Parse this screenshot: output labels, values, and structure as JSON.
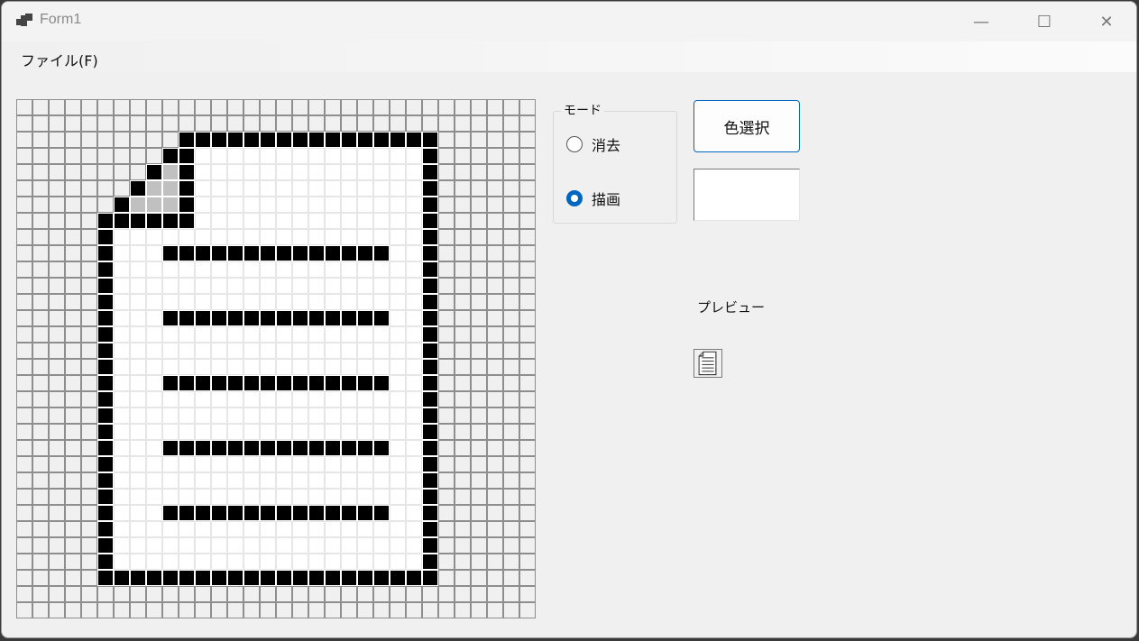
{
  "window": {
    "title": "Form1",
    "minimize_glyph": "—",
    "maximize_glyph": "☐",
    "close_glyph": "✕"
  },
  "menu": {
    "items": [
      {
        "label": "ファイル(F)"
      }
    ]
  },
  "mode_group": {
    "label": "モード",
    "options": [
      {
        "label": "消去",
        "checked": false
      },
      {
        "label": "描画",
        "checked": true
      }
    ]
  },
  "color_button": {
    "label": "色選択"
  },
  "selected_color": "#ffffff",
  "preview": {
    "label": "プレビュー"
  },
  "canvas": {
    "columns": 32,
    "rows": 32,
    "legend": {
      "T": "transparent",
      "W": "white",
      "B": "black",
      "G": "gray"
    },
    "pixels": [
      "TTTTTTTTTTTTTTTTTTTTTTTTTTTTTTTT",
      "TTTTTTTTTTTTTTTTTTTTTTTTTTTTTTTT",
      "TTTTTTTTTTBBBBBBBBBBBBBBBBTTTTTT",
      "TTTTTTTTTBBWWWWWWWWWWWWWWBTTTTTT",
      "TTTTTTTTBGBWWWWWWWWWWWWWWBTTTTTT",
      "TTTTTTTBGGBWWWWWWWWWWWWWWBTTTTTT",
      "TTTTTTBGGGBWWWWWWWWWWWWWWBTTTTTT",
      "TTTTTBBBBBBWWWWWWWWWWWWWWBTTTTTT",
      "TTTTTBWWWWWWWWWWWWWWWWWWWBTTTTTT",
      "TTTTTBWWWBBBBBBBBBBBBBBWWBTTTTTT",
      "TTTTTBWWWWWWWWWWWWWWWWWWWBTTTTTT",
      "TTTTTBWWWWWWWWWWWWWWWWWWWBTTTTTT",
      "TTTTTBWWWWWWWWWWWWWWWWWWWBTTTTTT",
      "TTTTTBWWWBBBBBBBBBBBBBBWWBTTTTTT",
      "TTTTTBWWWWWWWWWWWWWWWWWWWBTTTTTT",
      "TTTTTBWWWWWWWWWWWWWWWWWWWBTTTTTT",
      "TTTTTBWWWWWWWWWWWWWWWWWWWBTTTTTT",
      "TTTTTBWWWBBBBBBBBBBBBBBWWBTTTTTT",
      "TTTTTBWWWWWWWWWWWWWWWWWWWBTTTTTT",
      "TTTTTBWWWWWWWWWWWWWWWWWWWBTTTTTT",
      "TTTTTBWWWWWWWWWWWWWWWWWWWBTTTTTT",
      "TTTTTBWWWBBBBBBBBBBBBBBWWBTTTTTT",
      "TTTTTBWWWWWWWWWWWWWWWWWWWBTTTTTT",
      "TTTTTBWWWWWWWWWWWWWWWWWWWBTTTTTT",
      "TTTTTBWWWWWWWWWWWWWWWWWWWBTTTTTT",
      "TTTTTBWWWBBBBBBBBBBBBBBWWBTTTTTT",
      "TTTTTBWWWWWWWWWWWWWWWWWWWBTTTTTT",
      "TTTTTBWWWWWWWWWWWWWWWWWWWBTTTTTT",
      "TTTTTBWWWWWWWWWWWWWWWWWWWBTTTTTT",
      "TTTTTBBBBBBBBBBBBBBBBBBBBBTTTTTT",
      "TTTTTTTTTTTTTTTTTTTTTTTTTTTTTTTT",
      "TTTTTTTTTTTTTTTTTTTTTTTTTTTTTTTT"
    ]
  },
  "colors": {
    "accent": "#0067c0",
    "form_background": "#f0f0f0"
  }
}
